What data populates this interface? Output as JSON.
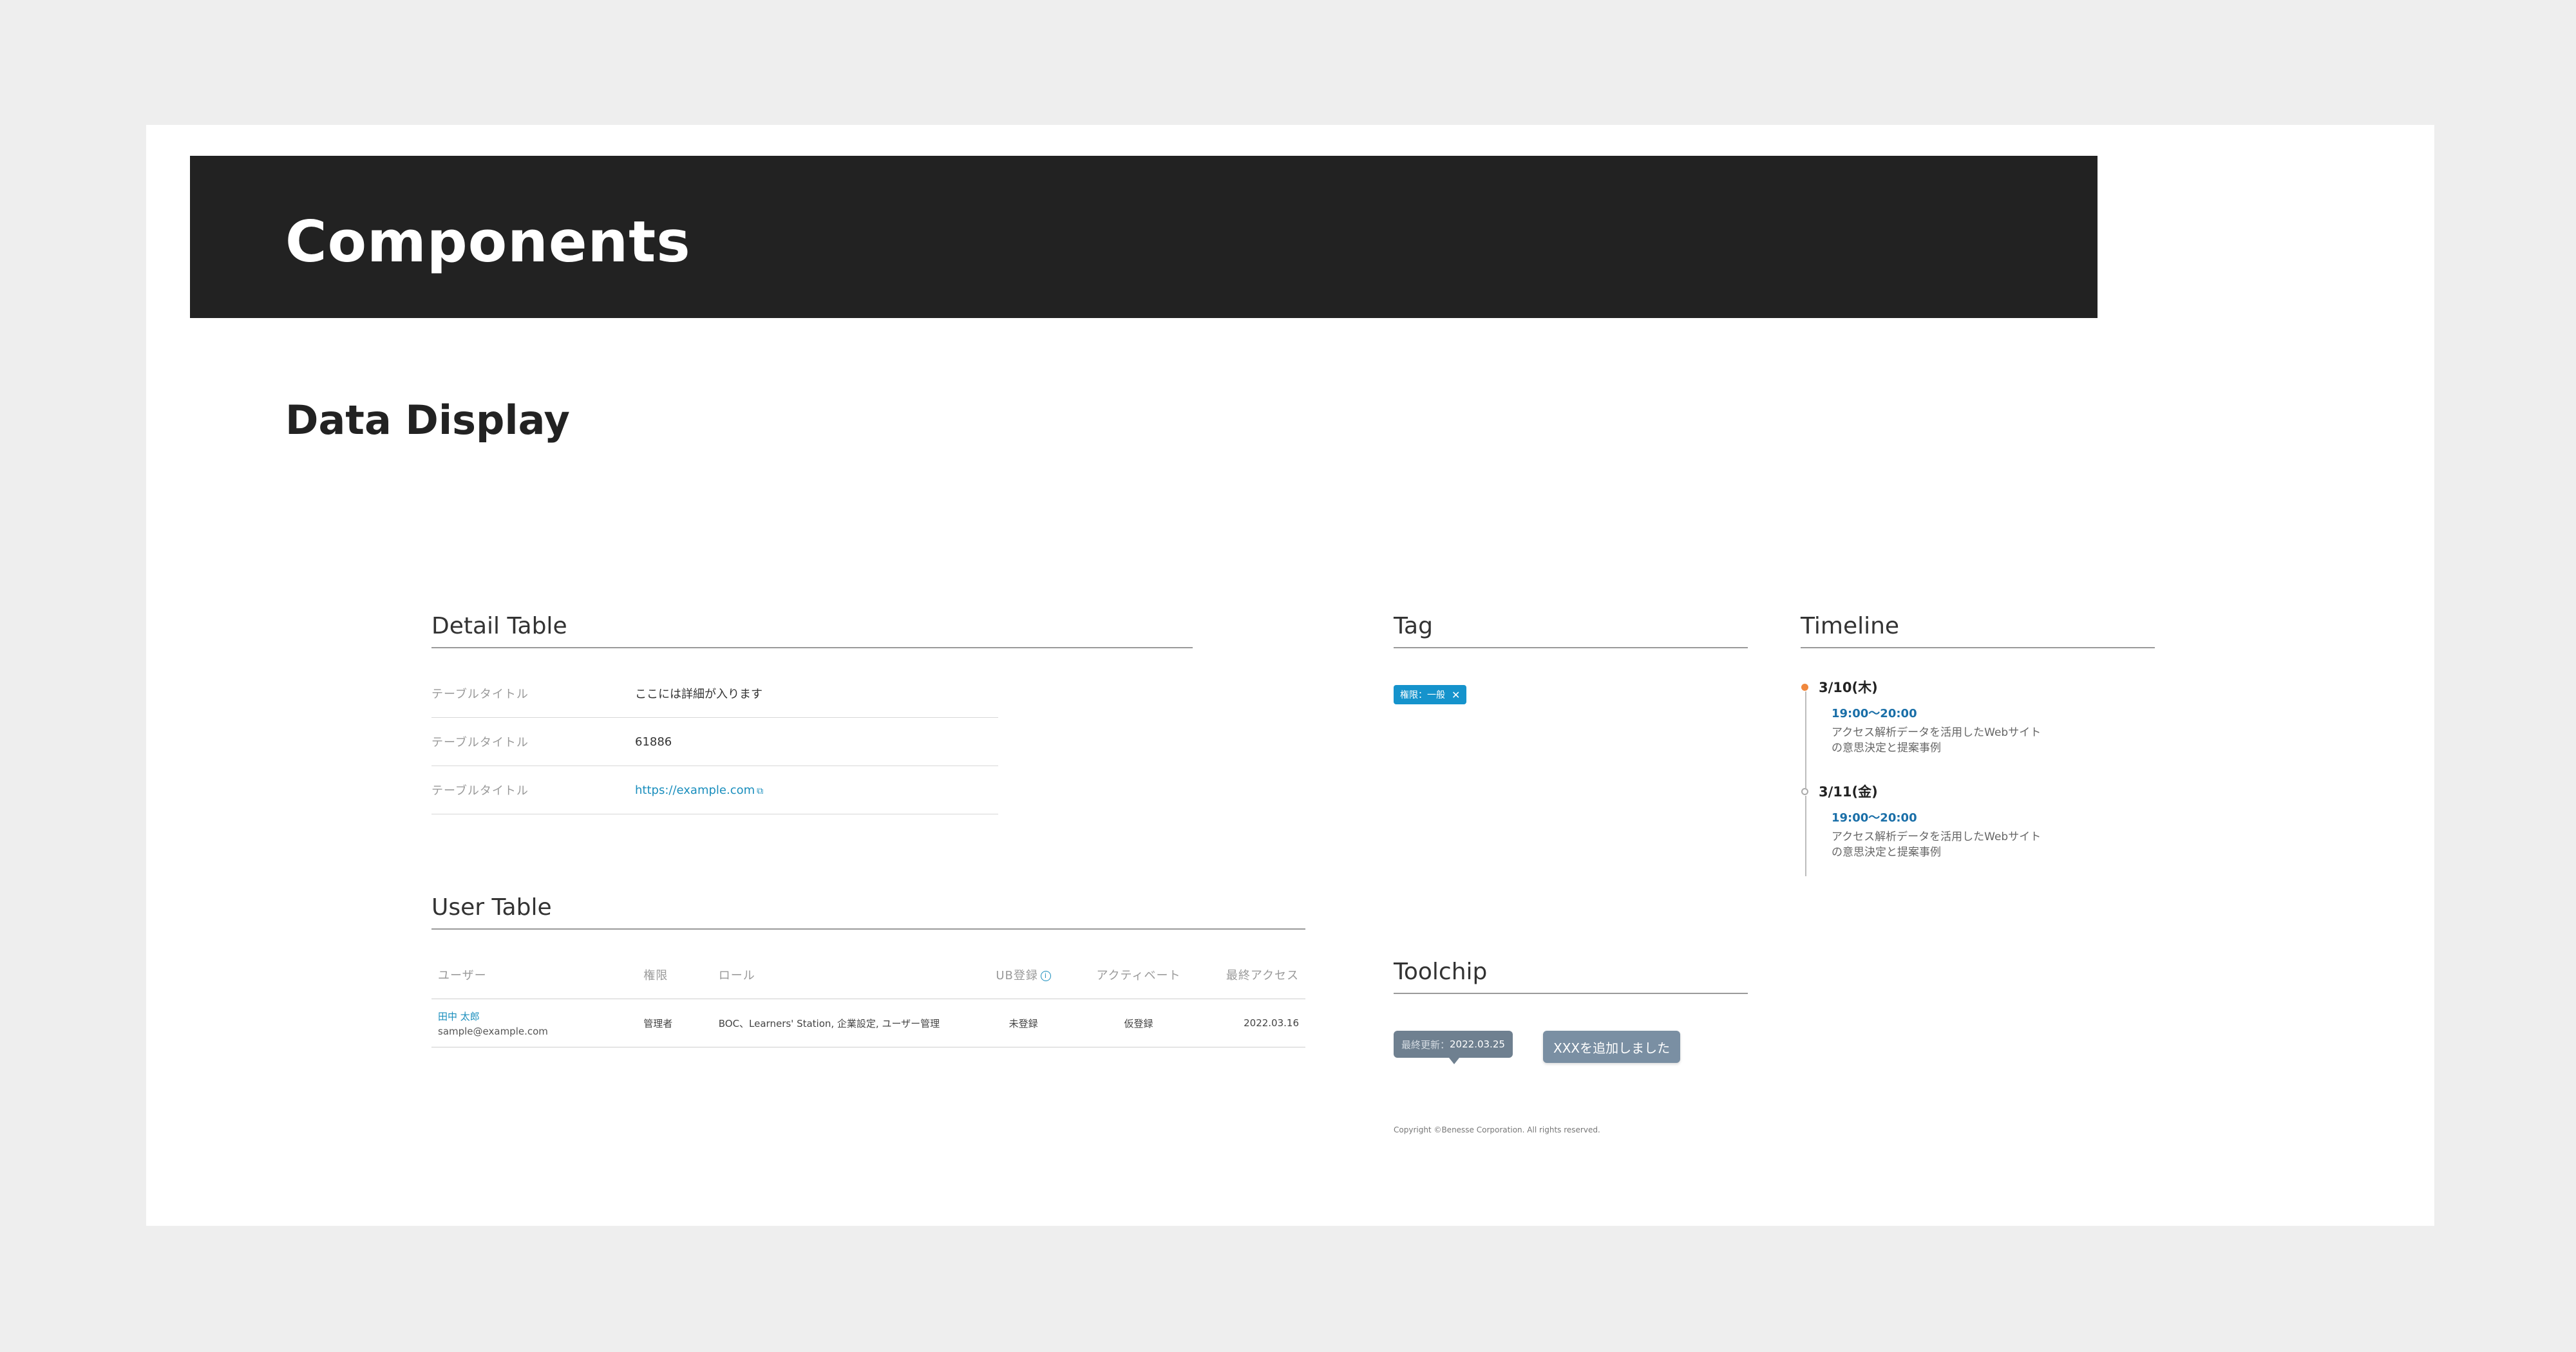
{
  "header": {
    "title": "Components"
  },
  "section": {
    "title": "Data Display"
  },
  "detail_table": {
    "title": "Detail Table",
    "rows": [
      {
        "label": "テーブルタイトル",
        "value": "ここには詳細が入ります"
      },
      {
        "label": "テーブルタイトル",
        "value": "61886"
      },
      {
        "label": "テーブルタイトル",
        "value": "https://example.com"
      }
    ]
  },
  "user_table": {
    "title": "User Table",
    "columns": [
      "ユーザー",
      "権限",
      "ロール",
      "UB登録",
      "アクティベート",
      "最終アクセス"
    ],
    "rows": [
      {
        "name": "田中 太郎",
        "email": "sample@example.com",
        "permission": "管理者",
        "roles": "BOC、Learners' Station, 企業設定, ユーザー管理",
        "ub_status": "未登録",
        "activate_status": "仮登録",
        "last_access": "2022.03.16"
      }
    ]
  },
  "tag": {
    "title": "Tag",
    "label": "権限：一般",
    "color": "#1593cc"
  },
  "timeline": {
    "title": "Timeline",
    "items": [
      {
        "date": "3/10(木)",
        "time": "19:00〜20:00",
        "desc": "アクセス解析データを活用したWebサイトの意思決定と提案事例",
        "active": true
      },
      {
        "date": "3/11(金)",
        "time": "19:00〜20:00",
        "desc": "アクセス解析データを活用したWebサイトの意思決定と提案事例",
        "active": false
      }
    ]
  },
  "toolchip": {
    "title": "Toolchip",
    "chip_label": "最終更新：",
    "chip_value": "2022.03.25",
    "button_label": "XXXを追加しました"
  },
  "footer": {
    "copyright": "Copyright ©Benesse Corporation. All rights reserved."
  },
  "colors": {
    "accent_blue": "#1593cc",
    "accent_orange": "#f0883e",
    "header_bg": "#222222"
  }
}
